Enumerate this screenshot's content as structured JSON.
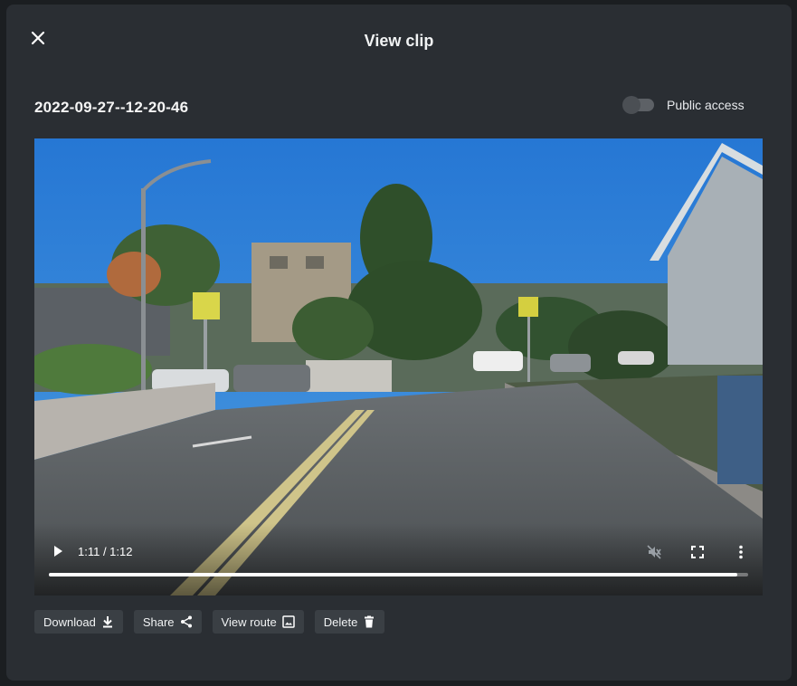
{
  "dialog": {
    "title": "View clip",
    "close_icon": "close-icon"
  },
  "clip": {
    "name": "2022-09-27--12-20-46",
    "public_access_label": "Public access",
    "public_access_enabled": false
  },
  "video": {
    "time_display": "1:11 / 1:12",
    "progress_fraction": 0.985,
    "muted": true,
    "icons": [
      "play-icon",
      "muted-volume-icon",
      "fullscreen-icon",
      "more-vertical-icon"
    ]
  },
  "actions": [
    {
      "label": "Download",
      "icon": "download-icon"
    },
    {
      "label": "Share",
      "icon": "share-icon"
    },
    {
      "label": "View route",
      "icon": "image-icon"
    },
    {
      "label": "Delete",
      "icon": "trash-icon"
    }
  ],
  "colors": {
    "dialog_bg": "#2a2e33",
    "page_bg": "#1b1e21",
    "button_bg": "#3a3f44",
    "sky": "#2d81da",
    "road": "#5c6063"
  }
}
